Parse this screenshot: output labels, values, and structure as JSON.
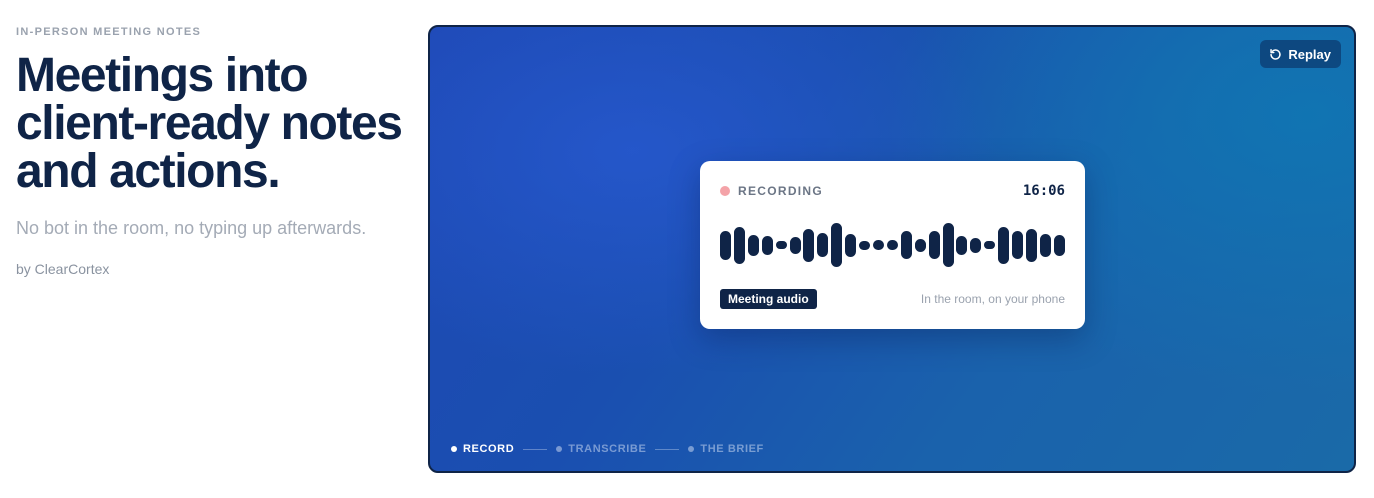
{
  "hero": {
    "eyebrow": "IN-PERSON MEETING NOTES",
    "headline": "Meetings into client-ready notes and actions.",
    "subhead": "No bot in the room, no typing up afterwards.",
    "byline": "by ClearCortex"
  },
  "demo": {
    "replay_label": "Replay",
    "replay_icon": "replay-icon",
    "card": {
      "status_label": "RECORDING",
      "timer": "16:06",
      "waveform_levels": [
        0.62,
        0.8,
        0.45,
        0.42,
        0.18,
        0.38,
        0.72,
        0.52,
        0.95,
        0.5,
        0.2,
        0.22,
        0.22,
        0.6,
        0.28,
        0.6,
        0.95,
        0.42,
        0.32,
        0.13,
        0.8,
        0.6,
        0.72,
        0.5,
        0.45
      ],
      "source_tag": "Meeting audio",
      "source_hint": "In the room, on your phone"
    },
    "steps": [
      {
        "label": "RECORD",
        "active": true
      },
      {
        "label": "TRANSCRIBE",
        "active": false
      },
      {
        "label": "THE BRIEF",
        "active": false
      }
    ]
  },
  "colors": {
    "navy": "#0f2447",
    "recording_dot": "#f4a3a8",
    "panel_blue": "#1e48b4"
  }
}
